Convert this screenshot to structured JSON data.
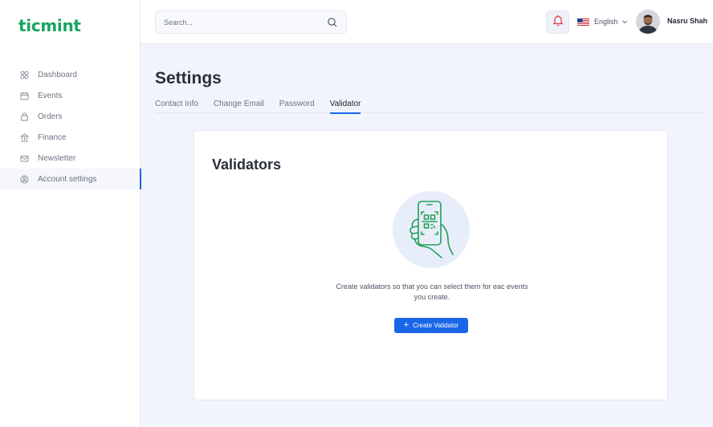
{
  "brand": {
    "name": "ticmint",
    "color": "#17a561"
  },
  "sidebar": {
    "items": [
      {
        "label": "Dashboard",
        "icon": "grid-icon",
        "active": false
      },
      {
        "label": "Events",
        "icon": "calendar-icon",
        "active": false
      },
      {
        "label": "Orders",
        "icon": "bag-icon",
        "active": false
      },
      {
        "label": "Finance",
        "icon": "bank-icon",
        "active": false
      },
      {
        "label": "Newsletter",
        "icon": "mail-icon",
        "active": false
      },
      {
        "label": "Account settings",
        "icon": "user-circle-icon",
        "active": true
      }
    ]
  },
  "header": {
    "search_placeholder": "Search...",
    "language": "English",
    "user_name": "Nasru Shah"
  },
  "page": {
    "title": "Settings",
    "tabs": [
      {
        "label": "Contact Info",
        "active": false
      },
      {
        "label": "Change Email",
        "active": false
      },
      {
        "label": "Password",
        "active": false
      },
      {
        "label": "Validator",
        "active": true
      }
    ]
  },
  "validators": {
    "title": "Validators",
    "description": "Create validators so that you can select them for eac events you create.",
    "button_label": "Create Validator"
  },
  "colors": {
    "accent": "#1a66e8",
    "brand_green": "#17a561",
    "background": "#f1f4fa"
  }
}
